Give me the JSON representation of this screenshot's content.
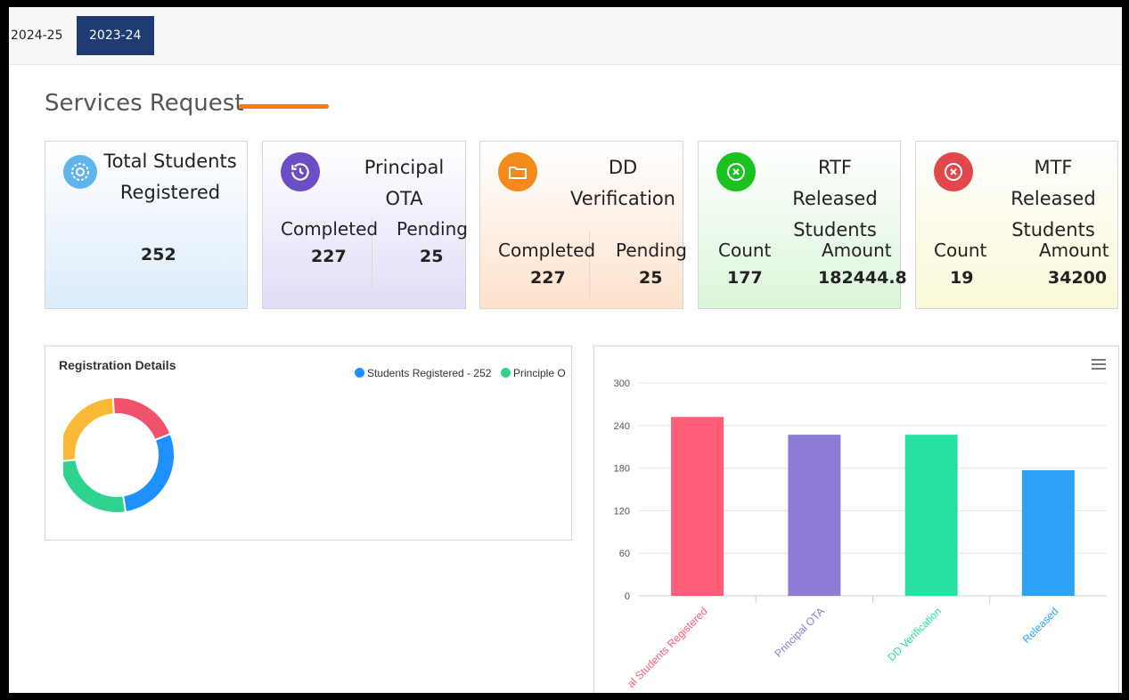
{
  "tabs": [
    {
      "label": "2024-25",
      "active": false
    },
    {
      "label": "2023-24",
      "active": true
    }
  ],
  "section": {
    "title": "Services Request"
  },
  "cards": [
    {
      "title_line1": "Total Students",
      "title_line2": "Registered",
      "value": "252",
      "icon": "gear-icon",
      "color": "#5fb4ec"
    },
    {
      "title_line1": "Principal OTA",
      "completed_label": "Completed",
      "completed": "227",
      "pending_label": "Pending",
      "pending": "25",
      "icon": "clock-refresh-icon",
      "color": "#6a4fc4"
    },
    {
      "title_line1": "DD",
      "title_line2": "Verification",
      "completed_label": "Completed",
      "completed": "227",
      "pending_label": "Pending",
      "pending": "25",
      "icon": "folder-icon",
      "color": "#f28a1c"
    },
    {
      "title_line1": "RTF Released",
      "title_line2": "Students",
      "count_label": "Count",
      "count": "177",
      "amount_label": "Amount",
      "amount": "182444.8",
      "icon": "close-circle-icon",
      "color": "#19c21e"
    },
    {
      "title_line1": "MTF Released",
      "title_line2": "Students",
      "count_label": "Count",
      "count": "19",
      "amount_label": "Amount",
      "amount": "34200",
      "icon": "close-circle-icon",
      "color": "#e2474c"
    }
  ],
  "chart_data": [
    {
      "type": "pie",
      "title": "Registration Details",
      "legend": [
        "Students Registered - 252",
        "Principle O"
      ],
      "slices": [
        {
          "value": 252,
          "color": "#1e90ff"
        },
        {
          "value": 227,
          "color": "#2ed38f"
        },
        {
          "value": 227,
          "color": "#f9b935"
        },
        {
          "value": 177,
          "color": "#f0516b"
        }
      ]
    },
    {
      "type": "bar",
      "categories": [
        "al Students Registered",
        "Principal OTA",
        "DD Verification",
        "Released"
      ],
      "values": [
        252,
        227,
        227,
        177
      ],
      "colors": [
        "#fe5c77",
        "#8f7ad6",
        "#27e0a2",
        "#2da3f7"
      ],
      "yticks": [
        0,
        60,
        120,
        180,
        240,
        300
      ],
      "ylim": [
        0,
        300
      ],
      "grid": true
    }
  ]
}
